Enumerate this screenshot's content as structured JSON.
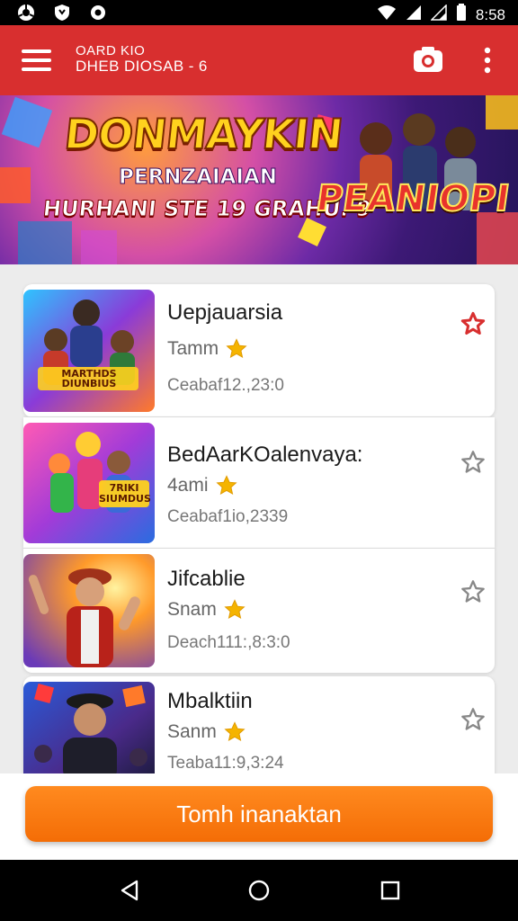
{
  "status_bar": {
    "time": "8:58",
    "icons": [
      "chrome-icon",
      "shield-icon",
      "circle-icon",
      "wifi-icon",
      "signal-icon",
      "battery-icon"
    ]
  },
  "app_bar": {
    "title_line1": "OARD KIO",
    "title_line2": "DHEB DIOSAB - 6",
    "icons": [
      "menu-icon",
      "camera-icon",
      "more-vert-icon"
    ],
    "color": "#d82f2f"
  },
  "banner": {
    "headline": "DONMAYKIN",
    "subheadline": "PERNZAIAIAN",
    "tagline": "HURHANI STE 19 GRAHU. 9",
    "logo_text": "PEANIOPI"
  },
  "games": [
    {
      "title": "Uepjauarsia",
      "rating_label": "Tamm",
      "date": "Ceabaf12.,23:0",
      "favorite": true,
      "thumb_text": "MARTHDS DIUNBIUS"
    },
    {
      "title": "BedAarKOalenvaya:",
      "rating_label": "4ami",
      "date": "Ceabaf1io,2339",
      "favorite": false,
      "thumb_text": "7RIKI SIUMDUS"
    },
    {
      "title": "Jifcablie",
      "rating_label": "Snam",
      "date": "Deach111:,8:3:0",
      "favorite": false,
      "thumb_text": ""
    },
    {
      "title": "Mbalktiin",
      "rating_label": "Sanm",
      "date": "Teaba11:9,3:24",
      "favorite": false,
      "thumb_text": ""
    }
  ],
  "cta": {
    "label": "Tomh inanaktan",
    "color": "#f47a12"
  },
  "nav_bar": {
    "icons": [
      "back-icon",
      "home-icon",
      "recents-icon"
    ]
  },
  "colors": {
    "star": "#f5b400",
    "favorite_active": "#d82f2f",
    "favorite_inactive": "#888888"
  }
}
